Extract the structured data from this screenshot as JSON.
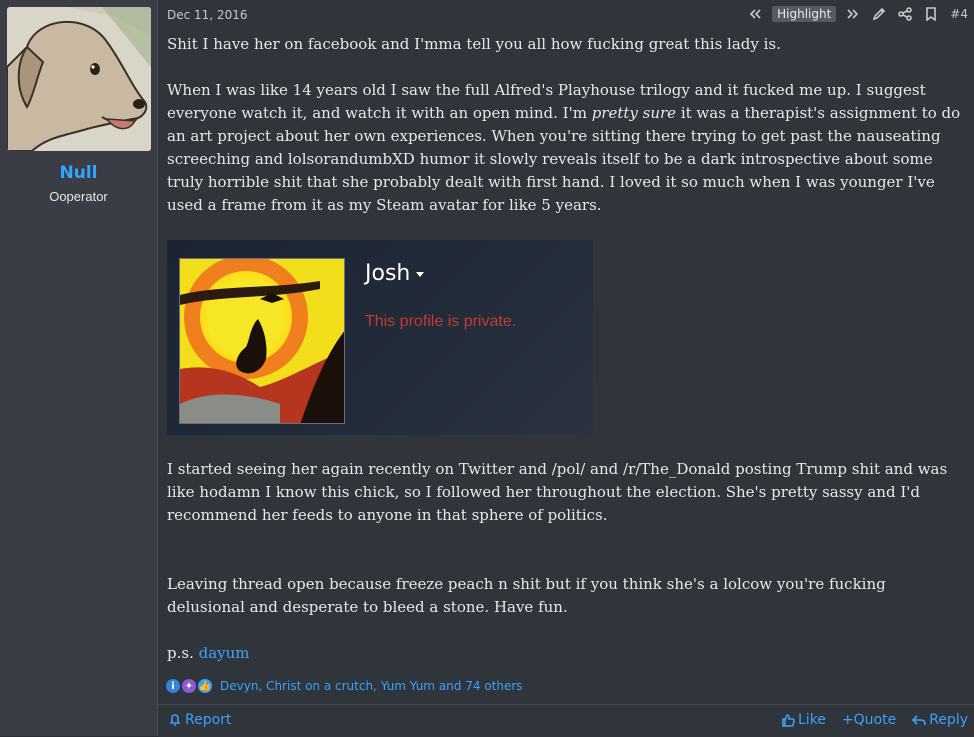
{
  "user": {
    "name": "Null",
    "title": "Ooperator",
    "avatar": "dog-avatar-image"
  },
  "post": {
    "date": "Dec 11, 2016",
    "highlight_label": "Highlight",
    "number": "#4",
    "paragraphs": {
      "p1": "Shit I have her on facebook and I'mma tell you all how fucking great this lady is.",
      "p2_before": "When I was like 14 years old I saw the full Alfred's Playhouse trilogy and it fucked me up. I suggest everyone watch it, and watch it with an open mind. I'm ",
      "p2_italic": "pretty sure",
      "p2_after": " it was a therapist's assignment to do an art project about her own experiences. When you're sitting there trying to get past the nauseating screeching and lolsorandumbXD humor it slowly reveals itself to be a dark introspective about some truly horrible shit that she probably dealt with first hand. I loved it so much when I was younger I've used a frame from it as my Steam avatar for like 5 years.",
      "p3": "I started seeing her again recently on Twitter and /pol/ and /r/The_Donald posting Trump shit and was like hodamn I know this chick, so I followed her throughout the election. She's pretty sassy and I'd recommend her feeds to anyone in that sphere of politics.",
      "p4": "Leaving thread open because freeze peach n shit but if you think she's a lolcow you're fucking delusional and desperate to bleed a stone. Have fun.",
      "ps_prefix": "p.s.",
      "ps_link": "dayum"
    },
    "embed": {
      "name": "Josh",
      "status": "This profile is private."
    },
    "reactions": {
      "icons": [
        "informative-icon",
        "puzzle-icon",
        "like-icon"
      ],
      "text": "Devyn, Christ on a crutch, Yum Yum and 74 others"
    }
  },
  "footer": {
    "report": "Report",
    "like": "Like",
    "quote": "+Quote",
    "reply": "Reply"
  },
  "colors": {
    "link": "#3aa1ff",
    "username": "#2ea8ff",
    "private_text": "#c23b33",
    "background": "#30343b",
    "sidebar": "#3a3d45"
  }
}
